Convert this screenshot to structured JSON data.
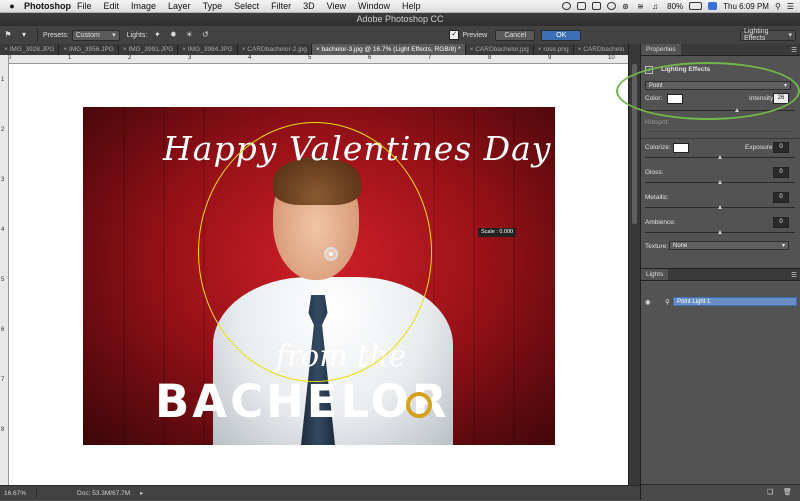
{
  "menubar": {
    "app_name": "Photoshop",
    "items": [
      "File",
      "Edit",
      "Image",
      "Layer",
      "Type",
      "Select",
      "Filter",
      "3D",
      "View",
      "Window",
      "Help"
    ],
    "battery": "80%",
    "clock": "Thu 6:09 PM"
  },
  "window": {
    "title": "Adobe Photoshop CC"
  },
  "options": {
    "presets_label": "Presets:",
    "presets_value": "Custom",
    "lights_label": "Lights:",
    "preview_label": "Preview",
    "preview_checked": true,
    "cancel_label": "Cancel",
    "ok_label": "OK",
    "workspace_value": "Lighting Effects"
  },
  "tabs": [
    {
      "label": "IMG_3928.JPG"
    },
    {
      "label": "IMG_3956.JPG"
    },
    {
      "label": "IMG_3991.JPG"
    },
    {
      "label": "IMG_3984.JPG"
    },
    {
      "label": "CARDbachelor-2.jpg"
    },
    {
      "label": "bachelor-3.jpg @ 16.7% (Light Effects, RGB/8) *"
    },
    {
      "label": "CARDbachelor.jpg"
    },
    {
      "label": "rose.png"
    },
    {
      "label": "CARDbachelo"
    }
  ],
  "ruler": {
    "top": [
      "0",
      "1",
      "2",
      "3",
      "4",
      "5",
      "6",
      "7",
      "8",
      "9",
      "10"
    ],
    "left": [
      "1",
      "2",
      "3",
      "4",
      "5",
      "6",
      "7",
      "8"
    ]
  },
  "canvas": {
    "headline": "Happy Valentines Day",
    "subline": "from the",
    "brand": "BACHELOR",
    "scale_badge": "Scale : 0.000"
  },
  "status": {
    "zoom": "16.67%",
    "doc": "Doc: 53.3M/67.7M"
  },
  "properties": {
    "tab_label": "Properties",
    "title": "Lighting Effects",
    "light_type": "Point",
    "color_label": "Color:",
    "intensity_label": "Intensity:",
    "intensity_value": "26",
    "hotspot_label": "Hotspot:",
    "colorize_label": "Colorize:",
    "exposure_label": "Exposure:",
    "exposure_value": "0",
    "gloss_label": "Gloss:",
    "gloss_value": "0",
    "metallic_label": "Metallic:",
    "metallic_value": "0",
    "ambience_label": "Ambience:",
    "ambience_value": "0",
    "texture_label": "Texture:",
    "texture_value": "None"
  },
  "lights_panel": {
    "tab_label": "Lights",
    "item": "Point Light 1"
  },
  "colors": {
    "panel_bg": "#535353",
    "light_ring": "#e8e000",
    "annotation_green": "#6fb64a",
    "selection_blue": "#3d6fb6"
  }
}
